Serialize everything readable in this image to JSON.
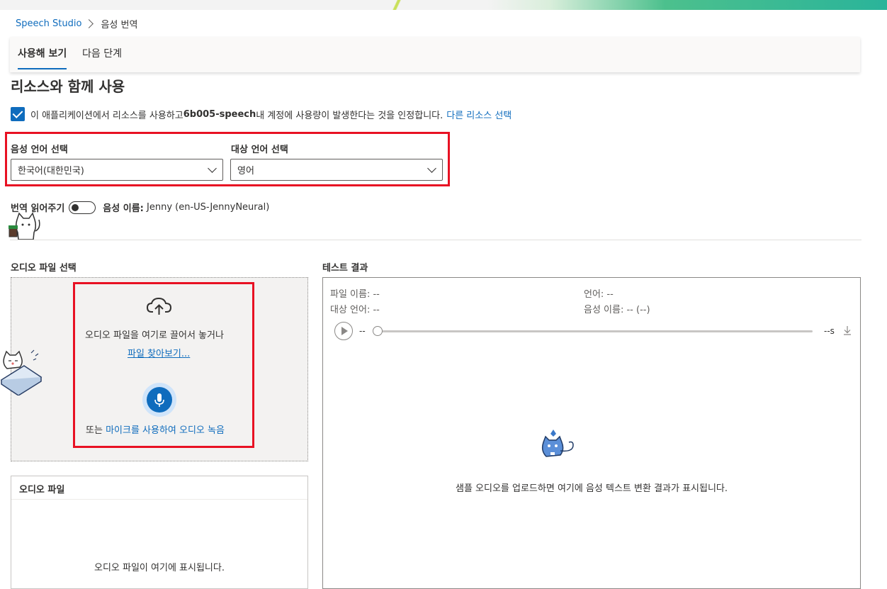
{
  "breadcrumb": {
    "root": "Speech Studio",
    "current": "음성 번역"
  },
  "tabs": [
    {
      "label": "사용해 보기",
      "active": true
    },
    {
      "label": "다음 단계",
      "active": false
    }
  ],
  "resource": {
    "title": "리소스와 함께 사용",
    "consent_prefix": "이 애플리케이션에서 리소스를 사용하고 ",
    "resource_name": "6b005-speech",
    "consent_suffix": " 내 계정에 사용량이 발생한다는 것을 인정합니다.",
    "change_link": "다른 리소스 선택",
    "checked": true
  },
  "languages": {
    "source_label": "음성 언어 선택",
    "source_value": "한국어(대한민국)",
    "target_label": "대상 언어 선택",
    "target_value": "영어"
  },
  "readout": {
    "label": "번역 읽어주기",
    "enabled": false,
    "voice_label": "음성 이름:",
    "voice_value": "Jenny (en-US-JennyNeural)"
  },
  "upload": {
    "title": "오디오 파일 선택",
    "drop_text": "오디오 파일을 여기로 끌어서 놓거나",
    "browse_link": "파일 찾아보기...",
    "or_text": "또는 ",
    "mic_link": "마이크를 사용하여 오디오 녹음"
  },
  "audio_file": {
    "title": "오디오 파일",
    "empty": "오디오 파일이 여기에 표시됩니다."
  },
  "results": {
    "title": "테스트 결과",
    "file_name": "파일 이름: --",
    "language": "언어: --",
    "target_language": "대상 언어: --",
    "voice_name": "음성 이름: -- (--)",
    "time_start": "--",
    "time_end": "--s",
    "empty": "샘플 오디오를 업로드하면 여기에 음성 텍스트 변환 결과가 표시됩니다."
  },
  "colors": {
    "accent": "#0f6cbd",
    "highlight": "#e81123"
  }
}
